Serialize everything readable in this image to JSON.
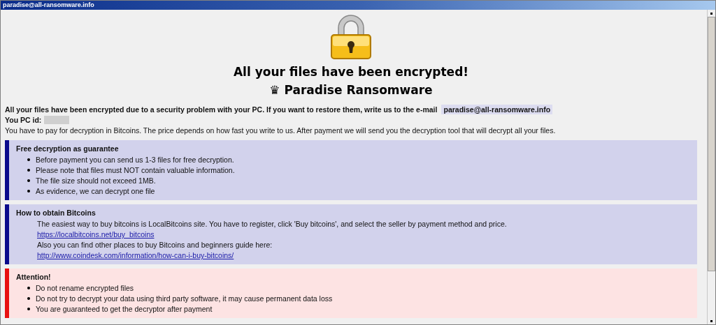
{
  "window": {
    "title": "paradise@all-ransomware.info"
  },
  "headline": "All your files have been encrypted!",
  "subheadline": "♛ Paradise Ransomware",
  "intro": {
    "text": "All your files have been encrypted due to a security problem with your PC. If you want to restore them, write us to the e-mail",
    "email": "paradise@all-ransomware.info"
  },
  "pc_id": {
    "label": "You PC id:"
  },
  "payment_note": "You have to pay for decryption in Bitcoins. The price depends on how fast you write to us. After payment we will send you the decryption tool that will decrypt all your files.",
  "sections": [
    {
      "kind": "info",
      "title": "Free decryption as guarantee",
      "items": [
        {
          "kind": "bullet",
          "text": "Before payment you can send us 1-3 files for free decryption."
        },
        {
          "kind": "bullet",
          "text": "Please note that files must NOT contain valuable information."
        },
        {
          "kind": "bullet",
          "text": "The file size should not exceed 1MB."
        },
        {
          "kind": "bullet",
          "text": "As evidence, we can decrypt one file"
        }
      ]
    },
    {
      "kind": "info",
      "title": "How to obtain Bitcoins",
      "items": [
        {
          "kind": "text",
          "text": "The easiest way to buy bitcoins is LocalBitcoins site. You have to register, click 'Buy bitcoins', and select the seller by payment method and price."
        },
        {
          "kind": "link",
          "text": "https://localbitcoins.net/buy_bitcoins"
        },
        {
          "kind": "text",
          "text": "Also you can find other places to buy Bitcoins and beginners guide here:"
        },
        {
          "kind": "link",
          "text": "http://www.coindesk.com/information/how-can-i-buy-bitcoins/"
        }
      ]
    },
    {
      "kind": "warning",
      "title": "Attention!",
      "items": [
        {
          "kind": "bullet",
          "text": "Do not rename encrypted files"
        },
        {
          "kind": "bullet",
          "text": "Do not try to decrypt your data using third party software, it may cause permanent data loss"
        },
        {
          "kind": "bullet",
          "text": "You are guaranteed to get the decryptor after payment"
        }
      ]
    }
  ]
}
